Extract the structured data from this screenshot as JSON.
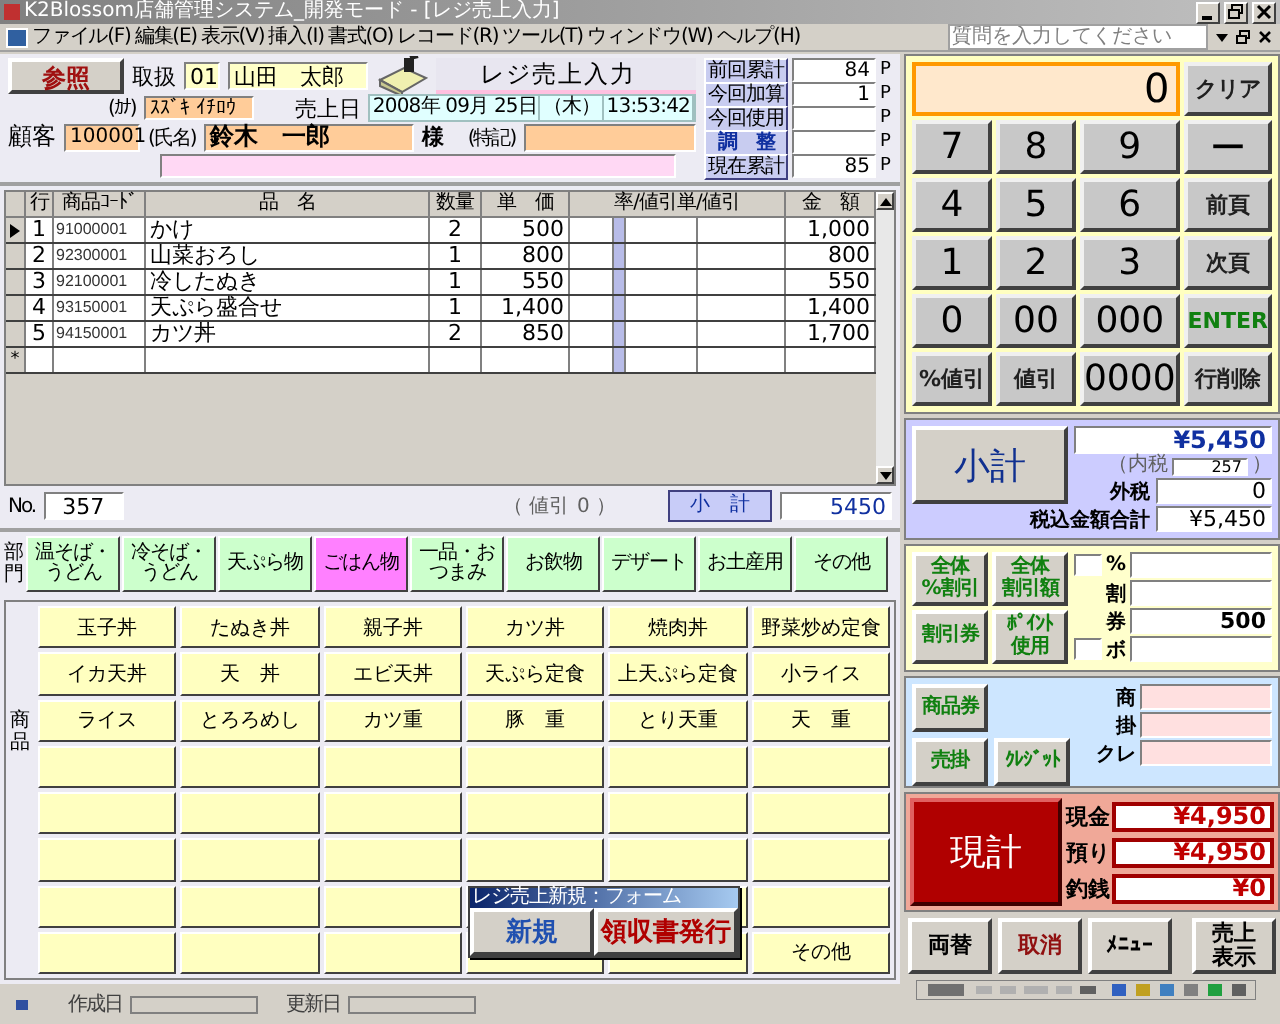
{
  "window": {
    "title": "K2Blossom店舗管理システム_開発モード - [レジ売上入力]"
  },
  "menu": [
    "ファイル(F)",
    "編集(E)",
    "表示(V)",
    "挿入(I)",
    "書式(O)",
    "レコード(R)",
    "ツール(T)",
    "ウィンドウ(W)",
    "ヘルプ(H)"
  ],
  "help_search": {
    "placeholder": "質問を入力してください"
  },
  "header": {
    "reference_button": "参照",
    "handler_label": "取扱",
    "handler_code": "01",
    "handler_name": "山田　太郎",
    "form_title": "レジ売上入力",
    "sale_date_label": "売上日",
    "sale_date": "2008年 09月 25日",
    "weekday": "（木）",
    "time": "13:53:42",
    "customer_label": "顧客",
    "customer_code": "100001",
    "kana_label": "(ｶﾅ)",
    "kana": "ｽｽﾞｷ ｲﾁﾛｳ",
    "name_label": "(氏名)",
    "name": "鈴木　一郎",
    "honorific": "様",
    "note_label": "(特記)"
  },
  "points": [
    {
      "label": "前回累計",
      "value": "84",
      "unit": "P",
      "kind": "plain"
    },
    {
      "label": "今回加算",
      "value": "1",
      "unit": "P",
      "kind": "plain"
    },
    {
      "label": "今回使用",
      "unit": "P",
      "kind": "plain"
    },
    {
      "label": "調　整",
      "unit": "P",
      "kind": "button"
    },
    {
      "label": "現在累計",
      "value": "85",
      "unit": "P",
      "kind": "plain"
    }
  ],
  "table": {
    "columns": [
      "行",
      "商品ｺｰﾄﾞ",
      "品　名",
      "数量",
      "単　価",
      "率/値引単/値引",
      "金　額"
    ],
    "rows": [
      {
        "line": "1",
        "code": "91000001",
        "name": "かけ",
        "qty": "2",
        "price": "500",
        "amount": "1,000",
        "current": true
      },
      {
        "line": "2",
        "code": "92300001",
        "name": "山菜おろし",
        "qty": "1",
        "price": "800",
        "amount": "800",
        "current": false
      },
      {
        "line": "3",
        "code": "92100001",
        "name": "冷したぬき",
        "qty": "1",
        "price": "550",
        "amount": "550",
        "current": false
      },
      {
        "line": "4",
        "code": "93150001",
        "name": "天ぷら盛合せ",
        "qty": "1",
        "price": "1,400",
        "amount": "1,400",
        "current": false
      },
      {
        "line": "5",
        "code": "94150001",
        "name": "カツ丼",
        "qty": "2",
        "price": "850",
        "amount": "1,700",
        "current": false
      }
    ],
    "new_row_marker": "*"
  },
  "footer": {
    "no_label": "No.",
    "no": "357",
    "discount_open": "（ 値引",
    "discount_value": "0 ）",
    "subtotal_label": "小　計",
    "subtotal": "5450"
  },
  "categories_label": "部門",
  "categories": [
    {
      "label": "温そば・うどん",
      "selected": false
    },
    {
      "label": "冷そば・うどん",
      "selected": false
    },
    {
      "label": "天ぷら物",
      "selected": false
    },
    {
      "label": "ごはん物",
      "selected": true
    },
    {
      "label": "一品・おつまみ",
      "selected": false
    },
    {
      "label": "お飲物",
      "selected": false
    },
    {
      "label": "デザート",
      "selected": false
    },
    {
      "label": "お土産用",
      "selected": false
    },
    {
      "label": "その他",
      "selected": false
    }
  ],
  "products_label": "商品",
  "products": [
    {
      "kind": "item",
      "label": "玉子丼"
    },
    {
      "kind": "item",
      "label": "たぬき丼"
    },
    {
      "kind": "item",
      "label": "親子丼"
    },
    {
      "kind": "item",
      "label": "カツ丼"
    },
    {
      "kind": "item",
      "label": "焼肉丼"
    },
    {
      "kind": "item",
      "label": "野菜炒め定食"
    },
    {
      "kind": "item",
      "label": "イカ天丼"
    },
    {
      "kind": "item",
      "label": "天　丼"
    },
    {
      "kind": "item",
      "label": "エビ天丼"
    },
    {
      "kind": "item",
      "label": "天ぷら定食"
    },
    {
      "kind": "item",
      "label": "上天ぷら定食"
    },
    {
      "kind": "item",
      "label": "小ライス"
    },
    {
      "kind": "item",
      "label": "ライス"
    },
    {
      "kind": "item",
      "label": "とろろめし"
    },
    {
      "kind": "item",
      "label": "カツ重"
    },
    {
      "kind": "item",
      "label": "豚　重"
    },
    {
      "kind": "item",
      "label": "とり天重"
    },
    {
      "kind": "item",
      "label": "天　重"
    },
    {
      "kind": "blank"
    },
    {
      "kind": "blank"
    },
    {
      "kind": "blank"
    },
    {
      "kind": "blank"
    },
    {
      "kind": "blank"
    },
    {
      "kind": "blank"
    },
    {
      "kind": "blank"
    },
    {
      "kind": "blank"
    },
    {
      "kind": "blank"
    },
    {
      "kind": "blank"
    },
    {
      "kind": "blank"
    },
    {
      "kind": "blank"
    },
    {
      "kind": "blank"
    },
    {
      "kind": "blank"
    },
    {
      "kind": "blank"
    },
    {
      "kind": "blank"
    },
    {
      "kind": "blank"
    },
    {
      "kind": "blank"
    },
    {
      "kind": "blank"
    },
    {
      "kind": "blank"
    },
    {
      "kind": "blank"
    },
    {
      "kind": "blank"
    },
    {
      "kind": "blank"
    },
    {
      "kind": "blank"
    },
    {
      "kind": "blank"
    },
    {
      "kind": "blank"
    },
    {
      "kind": "blank"
    },
    {
      "kind": "blank"
    },
    {
      "kind": "blank"
    },
    {
      "kind": "item",
      "label": "その他"
    }
  ],
  "popup": {
    "title": "レジ売上新規：フォーム",
    "buttons": [
      {
        "label": "新規",
        "kind": "new"
      },
      {
        "label": "領収書発行",
        "kind": "receipt"
      }
    ]
  },
  "status": {
    "created_label": "作成日",
    "updated_label": "更新日"
  },
  "keypad": {
    "display": "0",
    "keys": [
      {
        "label": "クリア",
        "kind": "func"
      },
      {
        "label": "7",
        "kind": "digit"
      },
      {
        "label": "8",
        "kind": "digit"
      },
      {
        "label": "9",
        "kind": "digit"
      },
      {
        "label": "ー",
        "kind": "digit"
      },
      {
        "label": "4",
        "kind": "digit"
      },
      {
        "label": "5",
        "kind": "digit"
      },
      {
        "label": "6",
        "kind": "digit"
      },
      {
        "label": "前頁",
        "kind": "func"
      },
      {
        "label": "1",
        "kind": "digit"
      },
      {
        "label": "2",
        "kind": "digit"
      },
      {
        "label": "3",
        "kind": "digit"
      },
      {
        "label": "次頁",
        "kind": "func"
      },
      {
        "label": "0",
        "kind": "digit"
      },
      {
        "label": "00",
        "kind": "digit"
      },
      {
        "label": "000",
        "kind": "digit"
      },
      {
        "label": "ENTER",
        "kind": "enter"
      },
      {
        "label": "%値引",
        "kind": "func"
      },
      {
        "label": "値引",
        "kind": "func"
      },
      {
        "label": "0000",
        "kind": "digit"
      },
      {
        "label": "行削除",
        "kind": "func"
      }
    ]
  },
  "totals": {
    "subtotal_button": "小計",
    "subtotal": "¥5,450",
    "inner_tax_open": "（内税",
    "inner_tax": "257",
    "inner_tax_close": "）",
    "outer_tax_label": "外税",
    "outer_tax": "0",
    "grand_label": "税込金額合計",
    "grand": "¥5,450"
  },
  "discounts": {
    "buttons": [
      {
        "lines": [
          "全体",
          "%割引"
        ]
      },
      {
        "lines": [
          "全体",
          "割引額"
        ]
      },
      {
        "lines": [
          "割引券"
        ]
      },
      {
        "lines": [
          "ﾎﾟｲﾝﾄ",
          "使用"
        ]
      }
    ],
    "fields": [
      {
        "label": "%",
        "has_input": true
      },
      {
        "label": "割",
        "has_input": false
      },
      {
        "label": "券",
        "value": "500",
        "has_input": false
      },
      {
        "label": "ボ",
        "has_input": true
      }
    ]
  },
  "payments": {
    "buttons": [
      "商品券",
      "売掛",
      "ｸﾚｼﾞｯﾄ"
    ],
    "fields": [
      "商",
      "掛",
      "クレ"
    ]
  },
  "cash": {
    "button": "現計",
    "rows": [
      {
        "label": "現金",
        "value": "¥4,950"
      },
      {
        "label": "預り",
        "value": "¥4,950"
      },
      {
        "label": "釣銭",
        "value": "¥0"
      }
    ]
  },
  "actions": [
    {
      "lines": [
        "両替"
      ],
      "kind": "plain"
    },
    {
      "lines": [
        "取消"
      ],
      "kind": "danger"
    },
    {
      "lines": [
        "ﾒﾆｭｰ"
      ],
      "kind": "plain"
    },
    {
      "lines": [
        "売上",
        "表示"
      ],
      "kind": "plain"
    }
  ]
}
